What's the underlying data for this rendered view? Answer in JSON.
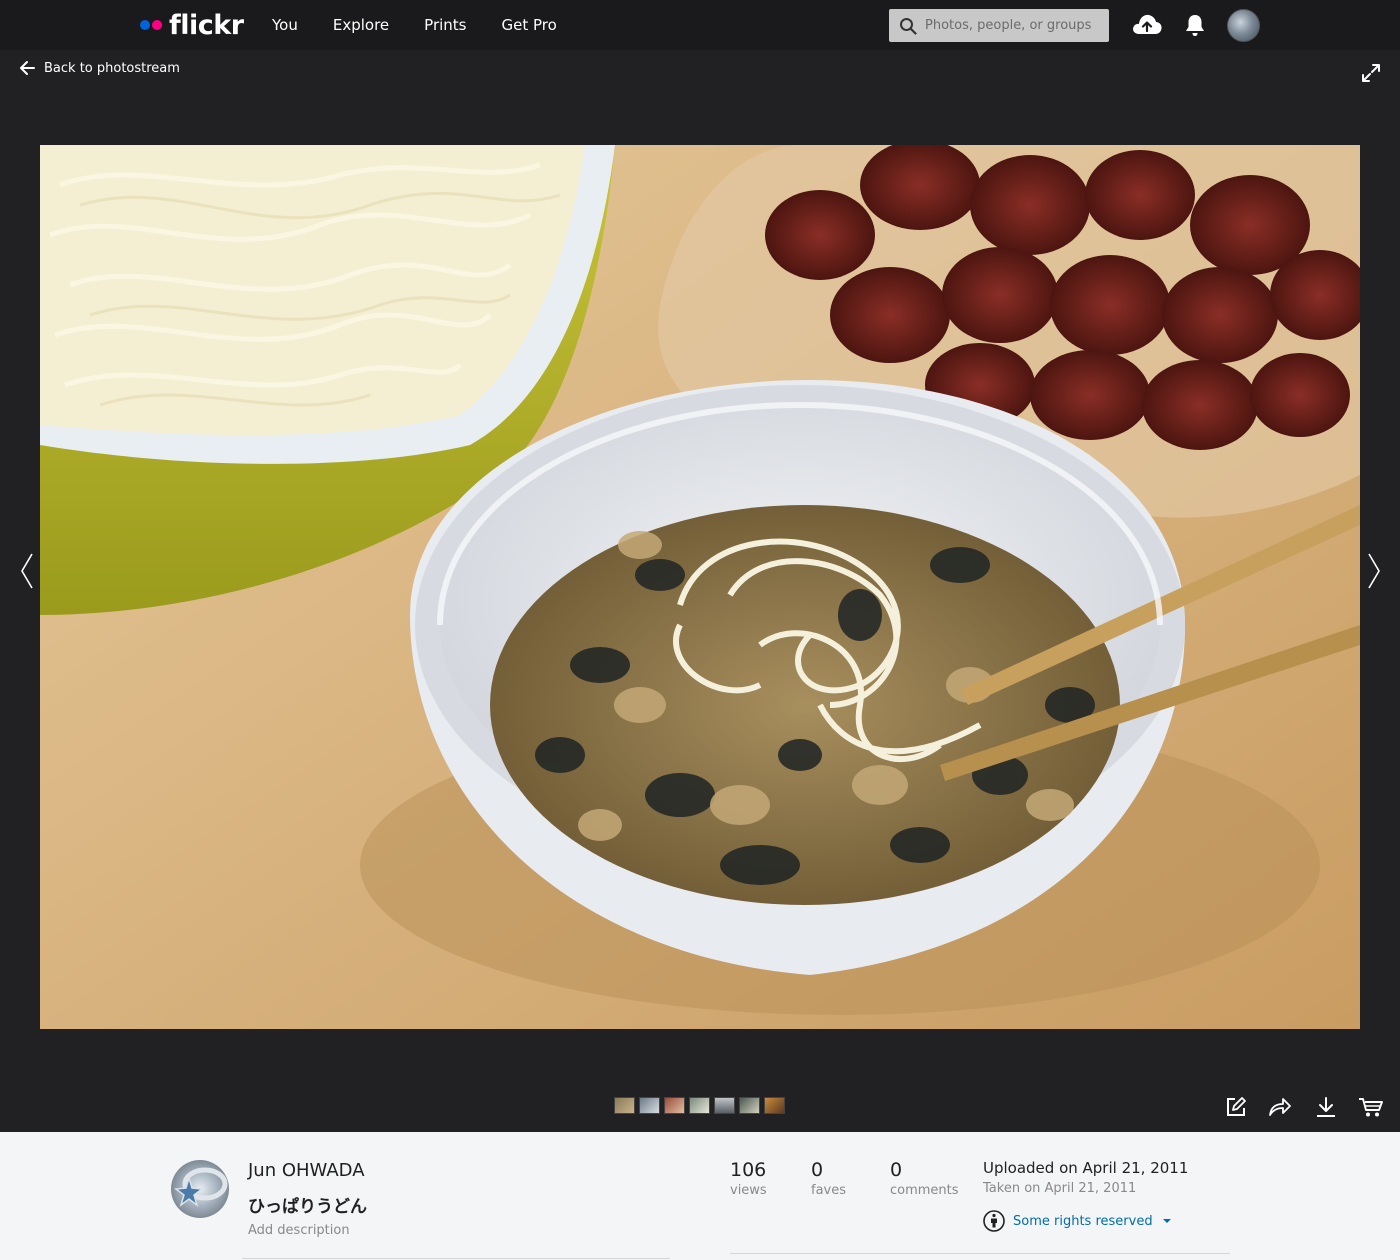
{
  "nav": {
    "logo": "flickr",
    "links": [
      "You",
      "Explore",
      "Prints",
      "Get Pro"
    ],
    "search_placeholder": "Photos, people, or groups",
    "brand_colors": {
      "blue": "#0063dc",
      "pink": "#ff0084"
    }
  },
  "viewer": {
    "back_label": "Back to photostream",
    "photo_alt": "ひっぱりうどん"
  },
  "owner": {
    "name": "Jun OHWADA",
    "title": "ひっぱりうどん",
    "add_description": "Add description"
  },
  "stats": [
    {
      "value": "106",
      "label": "views"
    },
    {
      "value": "0",
      "label": "faves"
    },
    {
      "value": "0",
      "label": "comments"
    }
  ],
  "dates": {
    "uploaded": "Uploaded on April 21, 2011",
    "taken": "Taken on April 21, 2011"
  },
  "license": {
    "label": "Some rights reserved",
    "color": "#006dac"
  },
  "icons": [
    "search-icon",
    "upload-icon",
    "bell-icon",
    "arrow-left-icon",
    "expand-icon",
    "chevron-left-icon",
    "chevron-right-icon",
    "edit-icon",
    "share-icon",
    "download-icon",
    "cart-icon",
    "cc-by-icon",
    "caret-down-icon"
  ]
}
